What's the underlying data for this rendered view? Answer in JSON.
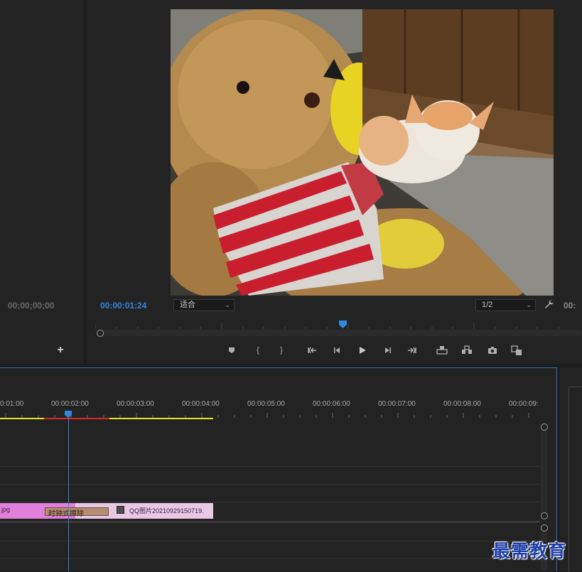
{
  "source": {
    "timecode": "00;00;00;00",
    "add_icon": "plus-icon"
  },
  "program": {
    "timecode": "00:00:01:24",
    "fit_select": "适合",
    "resolution_select": "1/2",
    "timecode_right_partial": "00:",
    "wrench_icon": "wrench-icon"
  },
  "controls": [
    {
      "name": "add-marker",
      "icon": "marker-icon"
    },
    {
      "name": "mark-in",
      "icon": "mark-in-icon"
    },
    {
      "name": "mark-out",
      "icon": "mark-out-icon"
    },
    {
      "name": "go-to-in",
      "icon": "go-to-in-icon"
    },
    {
      "name": "step-back",
      "icon": "step-back-icon"
    },
    {
      "name": "play",
      "icon": "play-icon"
    },
    {
      "name": "step-forward",
      "icon": "step-forward-icon"
    },
    {
      "name": "go-to-out",
      "icon": "go-to-out-icon"
    },
    {
      "name": "lift",
      "icon": "lift-icon"
    },
    {
      "name": "extract",
      "icon": "extract-icon"
    },
    {
      "name": "export-frame",
      "icon": "camera-icon"
    },
    {
      "name": "compare",
      "icon": "compare-icon"
    }
  ],
  "timeline": {
    "ruler": [
      "0:01:00",
      "00:00:02:00",
      "00:00:03:00",
      "00:00:04:00",
      "00:00:05:00",
      "00:00:06:00",
      "00:00:07:00",
      "00:00:08:00",
      "00:00:09:"
    ],
    "clip1_name": "jpg",
    "transition_name": "时钟式擦除",
    "clip2_name": "QQ图片20210929150719.",
    "fx_icon": "fx-badge-icon"
  },
  "watermark": "最需教育",
  "colors": {
    "accent": "#2f87e0",
    "clip_pink": "#e27fdc",
    "clip_light": "#e9c8e6",
    "render_yellow": "#e6e22a",
    "render_red": "#d9262a"
  }
}
